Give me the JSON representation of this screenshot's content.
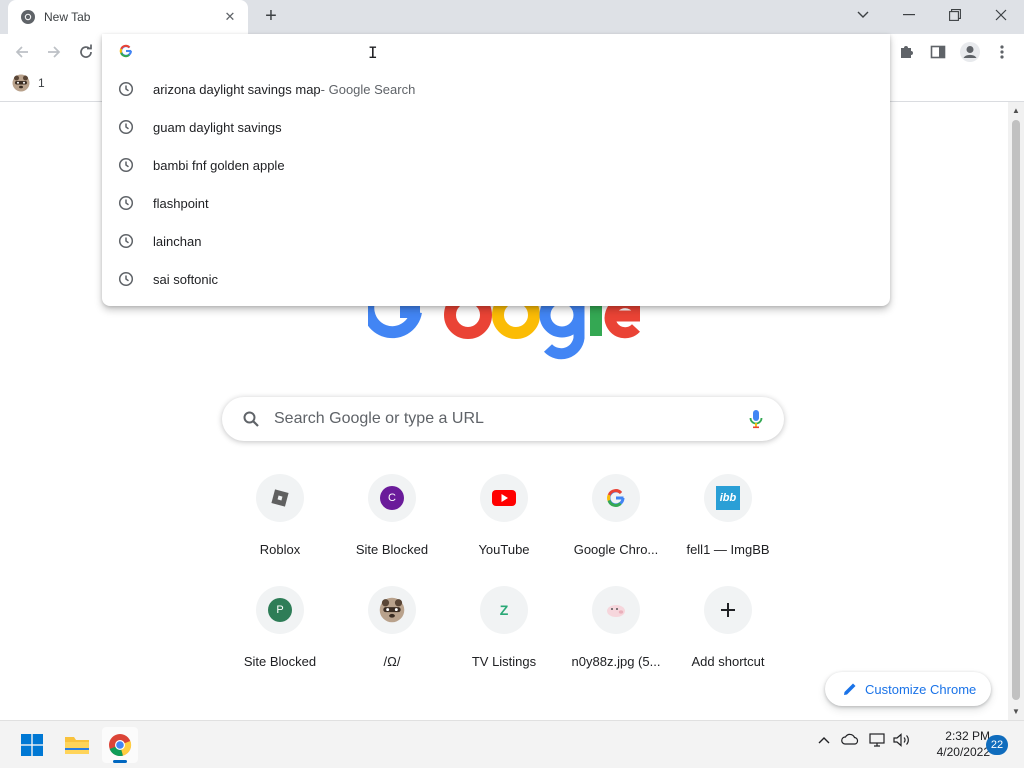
{
  "tab": {
    "title": "New Tab",
    "close": "✕",
    "new_tab": "+"
  },
  "window_controls": {
    "tabsearch": "⌄",
    "minimize": "—",
    "restore": "❐",
    "close": "✕"
  },
  "bookmarks_bar": {
    "item_label": "1"
  },
  "omnibox": {
    "suggestions": [
      {
        "text": "arizona daylight savings map",
        "sub": " - Google Search"
      },
      {
        "text": "guam daylight savings",
        "sub": ""
      },
      {
        "text": "bambi fnf golden apple",
        "sub": ""
      },
      {
        "text": "flashpoint",
        "sub": ""
      },
      {
        "text": "lainchan",
        "sub": ""
      },
      {
        "text": "sai softonic",
        "sub": ""
      }
    ]
  },
  "search": {
    "placeholder": "Search Google or type a URL"
  },
  "shortcuts": [
    {
      "label": "Roblox"
    },
    {
      "label": "Site Blocked",
      "letter": "C"
    },
    {
      "label": "YouTube"
    },
    {
      "label": "Google Chro..."
    },
    {
      "label": "fell1 — ImgBB",
      "icon_text": "ibb"
    },
    {
      "label": "Site Blocked",
      "letter": "P"
    },
    {
      "label": "/Ω/"
    },
    {
      "label": "TV Listings",
      "icon_text": "Z"
    },
    {
      "label": "n0y88z.jpg (5..."
    },
    {
      "label": "Add shortcut",
      "icon_text": "+"
    }
  ],
  "customize": {
    "label": "Customize Chrome"
  },
  "taskbar": {
    "time": "2:32 PM",
    "date": "4/20/2022",
    "notifications": "22"
  },
  "colors": {
    "accent": "#1a73e8",
    "google_blue": "#4285f4",
    "google_red": "#ea4335",
    "google_yellow": "#fbbc05",
    "google_green": "#34a853"
  }
}
